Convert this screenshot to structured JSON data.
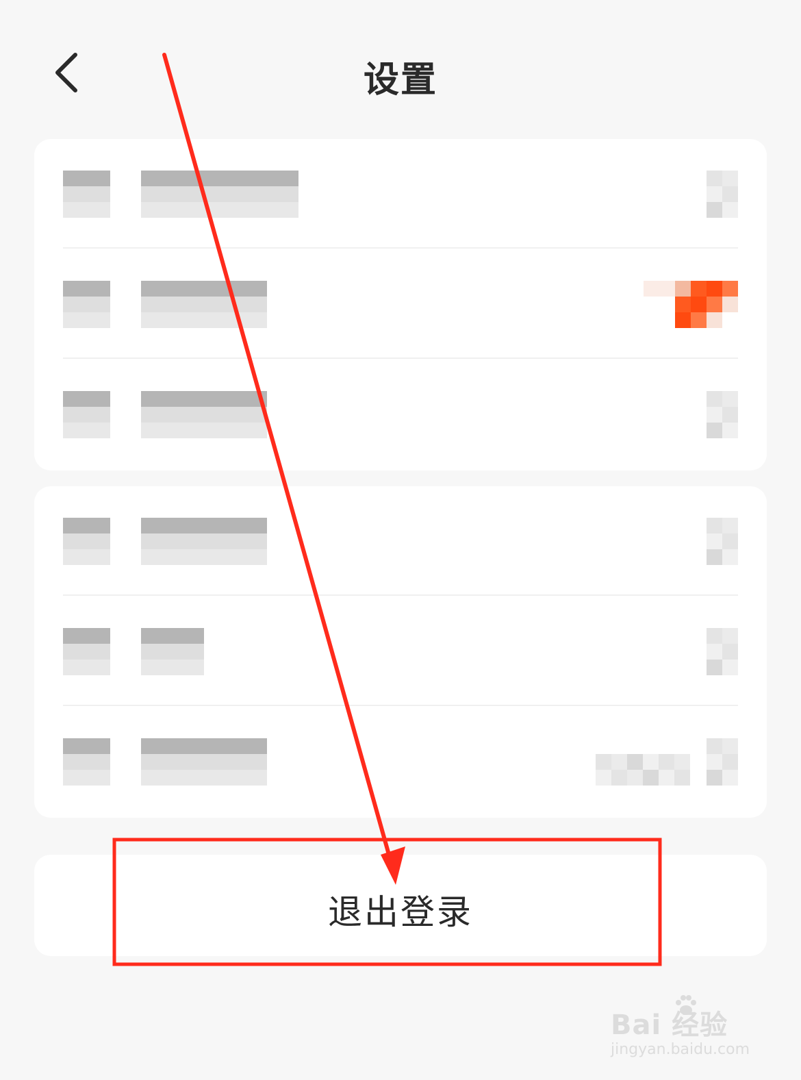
{
  "header": {
    "title": "设置",
    "back_icon": "chevron-left-icon"
  },
  "settings_cards": [
    {
      "rows": [
        {
          "icon": "blurred",
          "label": "blurred",
          "trailing": "chevron"
        },
        {
          "icon": "blurred",
          "label": "blurred",
          "trailing": "badge"
        },
        {
          "icon": "blurred",
          "label": "blurred",
          "trailing": "chevron"
        }
      ]
    },
    {
      "rows": [
        {
          "icon": "blurred",
          "label": "blurred",
          "trailing": "chevron"
        },
        {
          "icon": "blurred",
          "label": "blurred",
          "trailing": "chevron"
        },
        {
          "icon": "blurred",
          "label": "blurred",
          "trailing": "value-chevron"
        }
      ]
    }
  ],
  "logout": {
    "label": "退出登录"
  },
  "annotation": {
    "arrow_color": "#ff2b1c",
    "highlight_color": "#ff2b1c"
  },
  "watermark": {
    "brand": "Bai 经验",
    "url": "jingyan.baidu.com"
  },
  "colors": {
    "background": "#f7f7f7",
    "card": "#ffffff",
    "badge": "#ff5a1f",
    "text": "#2a2a2a"
  }
}
